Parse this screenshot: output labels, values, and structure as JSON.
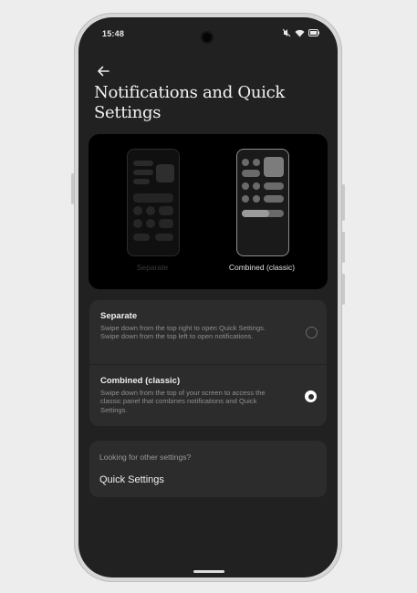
{
  "status_bar": {
    "time": "15:48"
  },
  "header": {
    "title": "Notifications and Quick Settings"
  },
  "preview": {
    "separate_label": "Separate",
    "combined_label": "Combined (classic)"
  },
  "options": [
    {
      "title": "Separate",
      "description": "Swipe down from the top right to open Quick Settings. Swipe down from the top left to open notifications.",
      "selected": false
    },
    {
      "title": "Combined (classic)",
      "description": "Swipe down from the top of your screen to access the classic panel that combines notifications and Quick Settings.",
      "selected": true
    }
  ],
  "other_settings": {
    "hint": "Looking for other settings?",
    "link": "Quick Settings"
  },
  "colors": {
    "accent": "#ffffff",
    "card": "#2c2c2c",
    "background": "#212121"
  }
}
